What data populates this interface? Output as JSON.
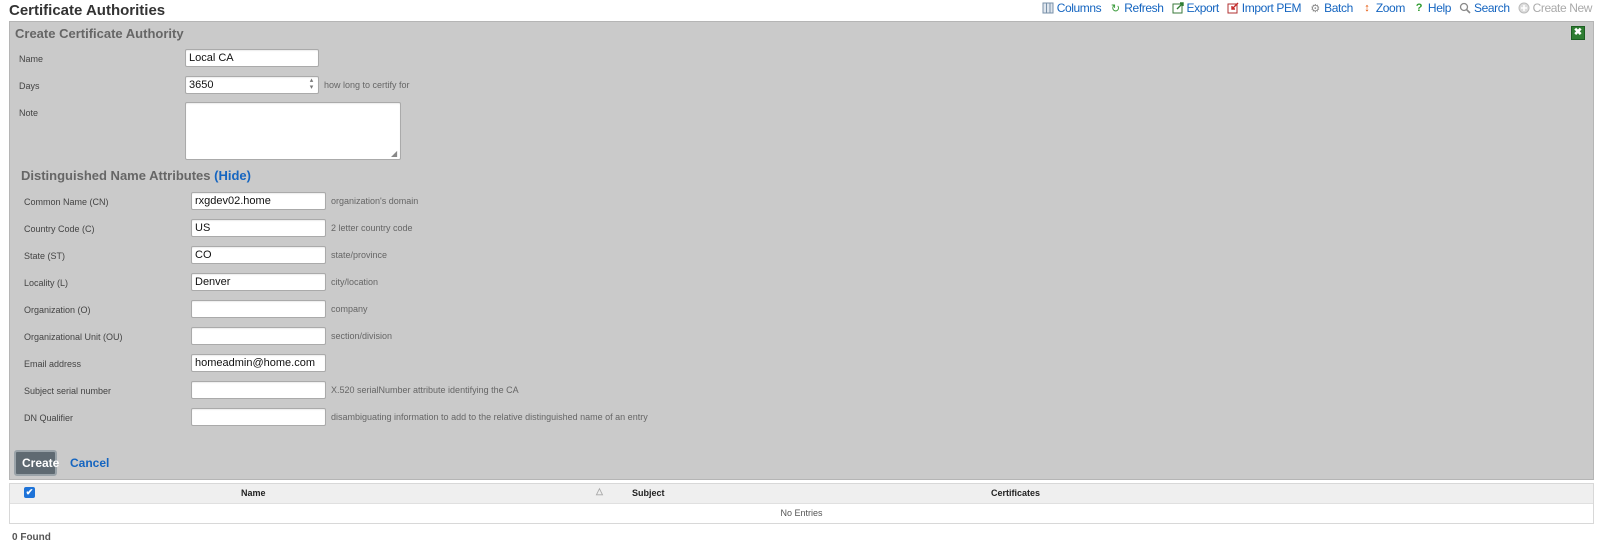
{
  "page": {
    "title": "Certificate Authorities"
  },
  "toolbar": {
    "columns": "Columns",
    "refresh": "Refresh",
    "export": "Export",
    "import_pem": "Import PEM",
    "batch": "Batch",
    "zoom": "Zoom",
    "help": "Help",
    "search": "Search",
    "create_new": "Create New"
  },
  "form": {
    "title": "Create Certificate Authority",
    "name": {
      "label": "Name",
      "value": "Local CA"
    },
    "days": {
      "label": "Days",
      "value": "3650",
      "hint": "how long to certify for"
    },
    "note": {
      "label": "Note",
      "value": ""
    },
    "dn": {
      "title": "Distinguished Name Attributes",
      "hide_link": "(Hide)",
      "fields": [
        {
          "label": "Common Name (CN)",
          "value": "rxgdev02.home",
          "hint": "organization's domain"
        },
        {
          "label": "Country Code (C)",
          "value": "US",
          "hint": "2 letter country code"
        },
        {
          "label": "State (ST)",
          "value": "CO",
          "hint": "state/province"
        },
        {
          "label": "Locality (L)",
          "value": "Denver",
          "hint": "city/location"
        },
        {
          "label": "Organization (O)",
          "value": "",
          "hint": "company"
        },
        {
          "label": "Organizational Unit (OU)",
          "value": "",
          "hint": "section/division"
        },
        {
          "label": "Email address",
          "value": "homeadmin@home.com",
          "hint": ""
        },
        {
          "label": "Subject serial number",
          "value": "",
          "hint": "X.520 serialNumber attribute identifying the CA"
        },
        {
          "label": "DN Qualifier",
          "value": "",
          "hint": "disambiguating information to add to the relative distinguished name of an entry"
        }
      ]
    },
    "create_label": "Create",
    "cancel_label": "Cancel"
  },
  "table": {
    "columns": [
      "Name",
      "Subject",
      "Certificates"
    ],
    "empty_text": "No Entries"
  },
  "footer": {
    "found_text": "0 Found"
  },
  "colors": {
    "link": "#1565c0",
    "panel_bg": "#cacaca",
    "close_green": "#2e7d32"
  }
}
